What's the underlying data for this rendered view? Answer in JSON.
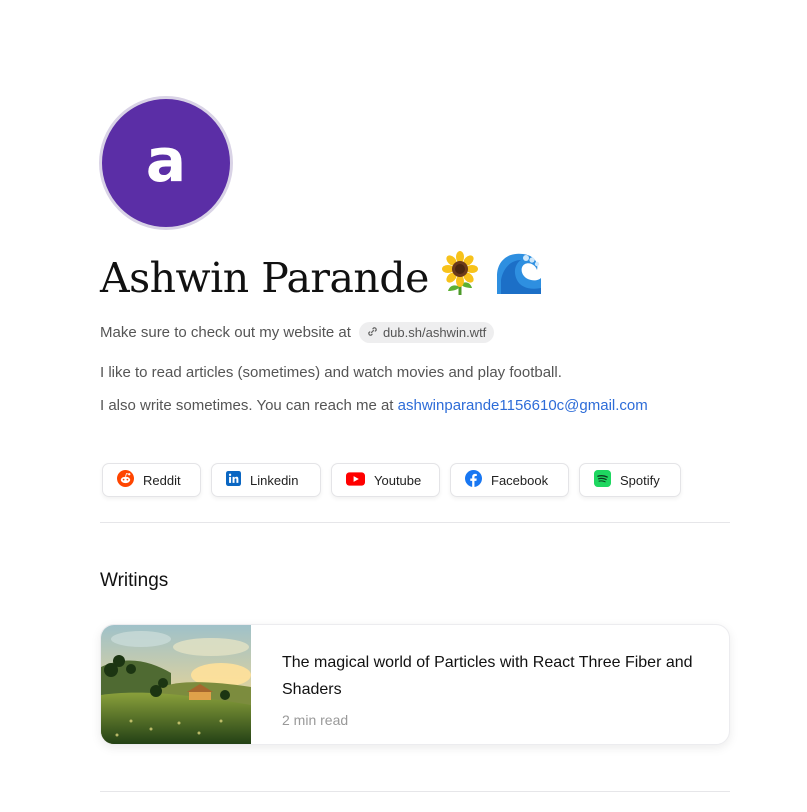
{
  "profile": {
    "avatar_letter": "a",
    "avatar_color": "#5b2ea6",
    "name": "Ashwin Parande",
    "name_emojis": [
      "sunflower-icon",
      "wave-icon"
    ]
  },
  "bio": {
    "line1_text": "Make sure to check out my website at",
    "website_link": "dub.sh/ashwin.wtf",
    "line2_text": "I like to read articles (sometimes) and watch movies and play football.",
    "line3_text": "I also write sometimes. You can reach me at",
    "email": "ashwinparande1156610c@gmail.com",
    "link_color": "#2d6cd8"
  },
  "socials": [
    {
      "label": "Reddit",
      "icon": "reddit-icon",
      "color": "#ff4500"
    },
    {
      "label": "Linkedin",
      "icon": "linkedin-icon",
      "color": "#0a66c2"
    },
    {
      "label": "Youtube",
      "icon": "youtube-icon",
      "color": "#ff0000"
    },
    {
      "label": "Facebook",
      "icon": "facebook-icon",
      "color": "#1877f2"
    },
    {
      "label": "Spotify",
      "icon": "spotify-icon",
      "color": "#1ed760"
    }
  ],
  "writings": {
    "section_title": "Writings",
    "articles": [
      {
        "title": "The magical world of Particles with React Three Fiber and Shaders",
        "read_time": "2 min read"
      }
    ]
  }
}
